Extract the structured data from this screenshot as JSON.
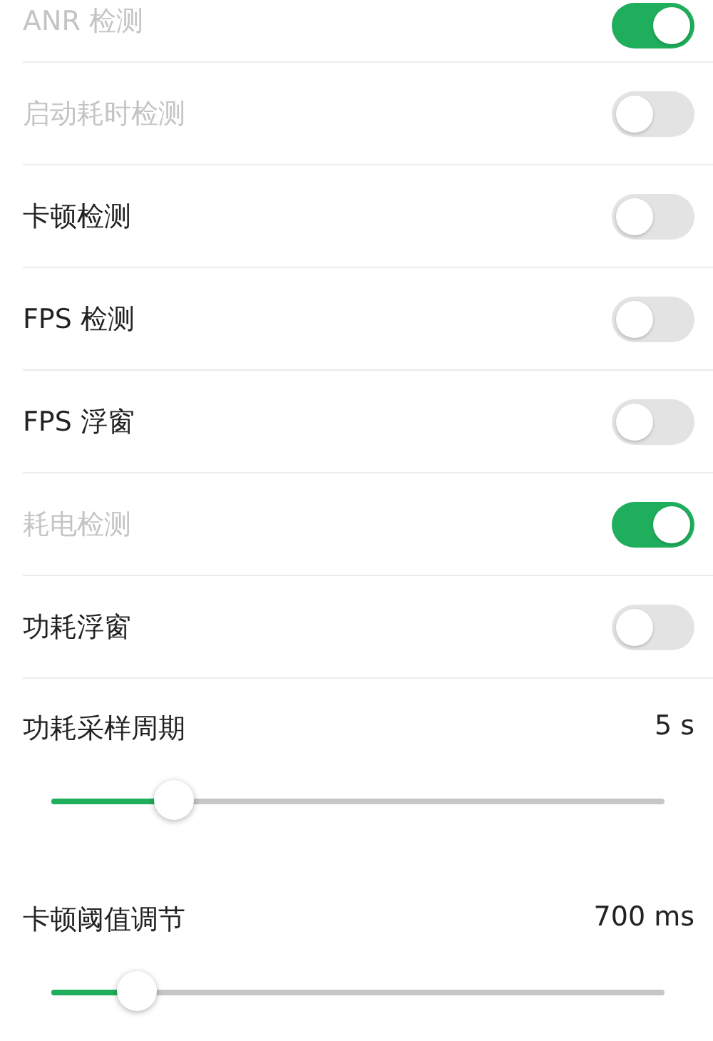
{
  "switches": [
    {
      "label": "ANR 检测",
      "on": true,
      "disabled": true
    },
    {
      "label": "启动耗时检测",
      "on": false,
      "disabled": true
    },
    {
      "label": "卡顿检测",
      "on": false,
      "disabled": false
    },
    {
      "label": "FPS 检测",
      "on": false,
      "disabled": false
    },
    {
      "label": "FPS 浮窗",
      "on": false,
      "disabled": false
    },
    {
      "label": "耗电检测",
      "on": true,
      "disabled": true
    },
    {
      "label": "功耗浮窗",
      "on": false,
      "disabled": false
    }
  ],
  "sliders": [
    {
      "label": "功耗采样周期",
      "reading": "5 s",
      "level": 0.2
    },
    {
      "label": "卡顿阈值调节",
      "reading": "700 ms",
      "level": 0.14
    }
  ]
}
